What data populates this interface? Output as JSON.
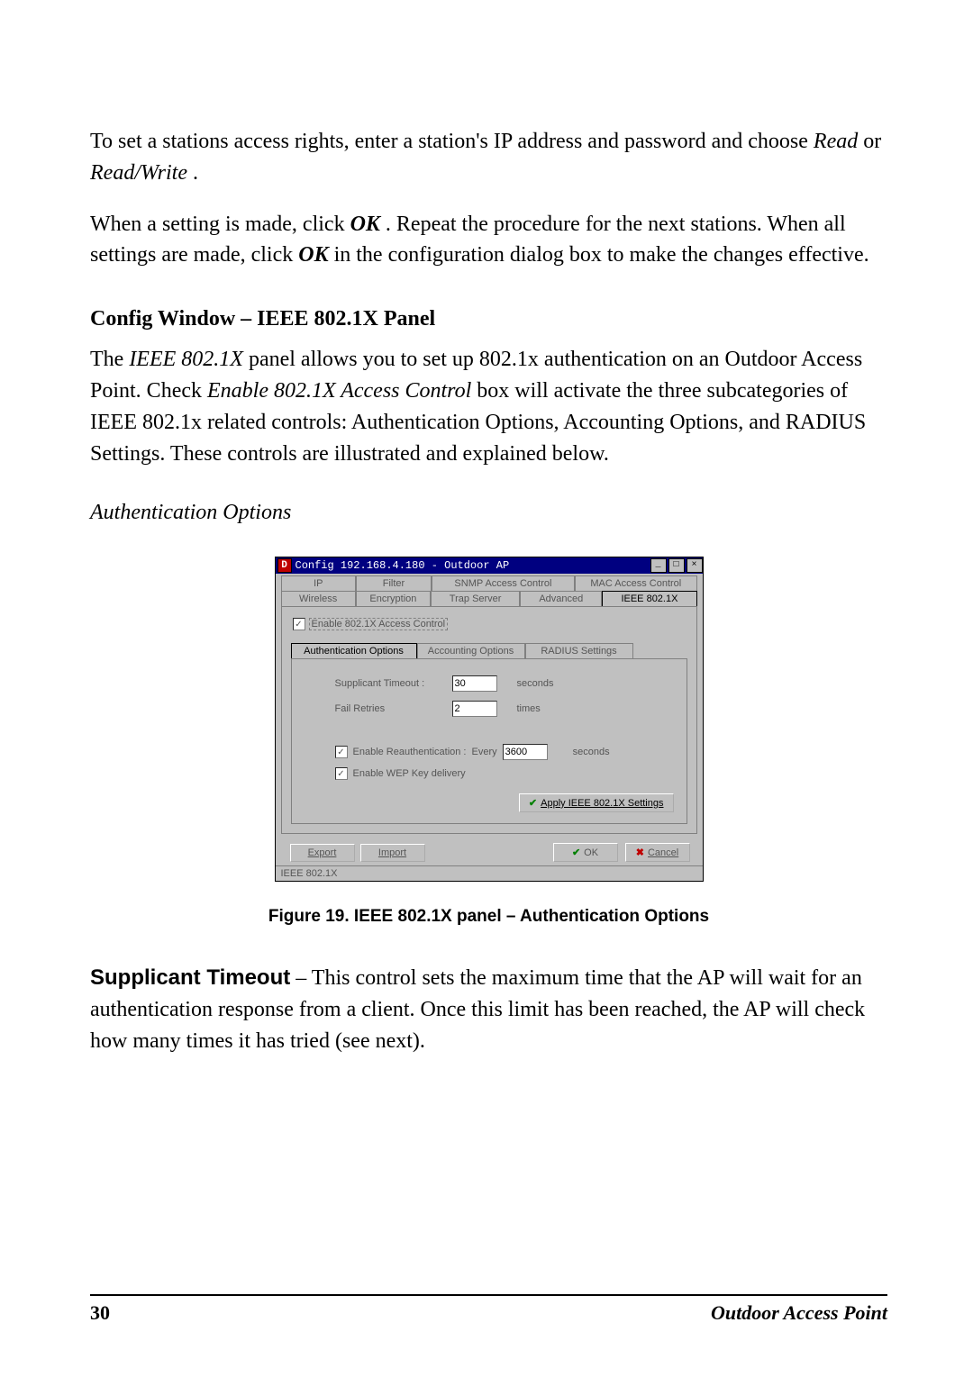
{
  "para1_a": "To set a stations access rights, enter a station's IP address and password and choose ",
  "para1_read": "Read",
  "para1_or": " or ",
  "para1_rw": "Read/Write",
  "para1_end": ".",
  "para2_a": "When a setting is made, click ",
  "para2_ok1": "OK",
  "para2_b": ". Repeat the procedure for the next stations. When all settings are made, click ",
  "para2_ok2": "OK",
  "para2_c": " in the configuration dialog box to make the changes effective.",
  "heading": "Config Window – IEEE 802.1X Panel",
  "para3_a": "The ",
  "para3_ieee": "IEEE 802.1X",
  "para3_b": " panel allows you to set up 802.1x authentication on an Outdoor Access Point. Check ",
  "para3_enable": "Enable 802.1X Access Control",
  "para3_c": " box will activate the three subcategories of IEEE 802.1x related controls: Authentication Options, Accounting Options, and RADIUS Settings. These controls are illustrated and explained below.",
  "subheading": "Authentication Options",
  "caption": "Figure 19.  IEEE 802.1X panel – Authentication Options",
  "para4_lead": "Supplicant Timeout",
  "para4_body": " – This control sets the maximum time that the AP will wait for an authentication response from a client. Once this limit has been reached, the AP will check how many times it has tried (see next).",
  "footer_page": "30",
  "footer_title": "Outdoor Access Point",
  "win": {
    "title": "Config 192.168.4.180 - Outdoor AP",
    "appicon": "D",
    "min": "_",
    "max": "□",
    "close": "×",
    "tabs_row1": {
      "ip": "IP",
      "filter": "Filter",
      "snmp": "SNMP Access Control",
      "mac": "MAC Access Control"
    },
    "tabs_row2": {
      "wireless": "Wireless",
      "encryption": "Encryption",
      "trap": "Trap Server",
      "advanced": "Advanced",
      "ieee": "IEEE 802.1X"
    },
    "enable_chk": "Enable 802.1X Access Control",
    "inner_tabs": {
      "auth": "Authentication Options",
      "acct": "Accounting Options",
      "radius": "RADIUS Settings"
    },
    "supp_label": "Supplicant Timeout :",
    "supp_value": "30",
    "supp_unit": "seconds",
    "fail_label": "Fail Retries",
    "fail_value": "2",
    "fail_unit": "times",
    "reauth_label": "Enable Reauthentication :",
    "reauth_every": "Every",
    "reauth_value": "3600",
    "reauth_unit": "seconds",
    "wep_label": "Enable WEP Key delivery",
    "apply": "Apply IEEE 802.1X Settings",
    "export": "Export",
    "import": "Import",
    "ok": "OK",
    "cancel": "Cancel",
    "status": "IEEE 802.1X"
  }
}
